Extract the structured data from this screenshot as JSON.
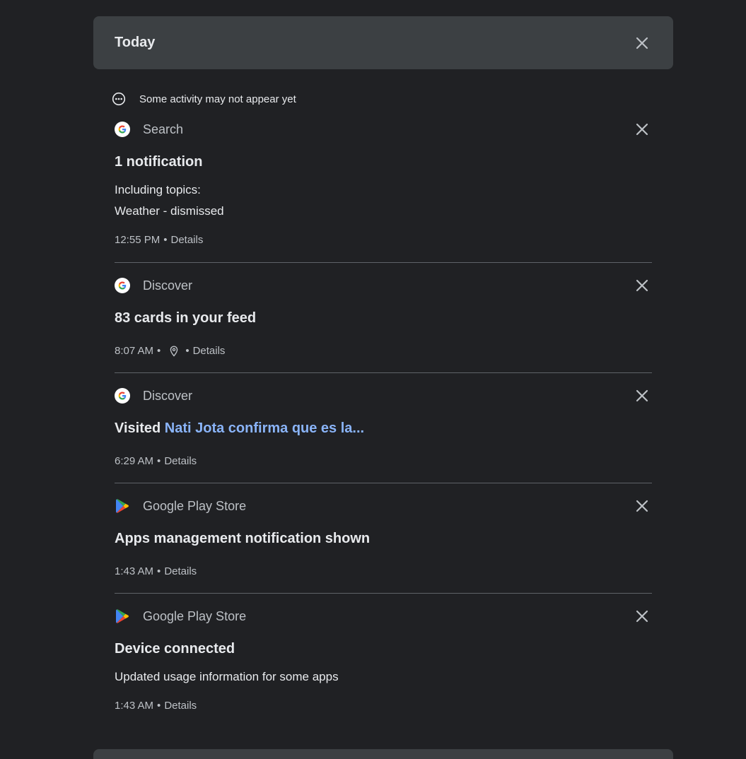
{
  "day": {
    "title": "Today"
  },
  "notice": {
    "text": "Some activity may not appear yet"
  },
  "cards": [
    {
      "app": "Search",
      "title": "1 notification",
      "lines": [
        "Including topics:",
        "Weather - dismissed"
      ],
      "time": "12:55 PM",
      "details": "Details"
    },
    {
      "app": "Discover",
      "title": "83 cards in your feed",
      "time": "8:07 AM",
      "details": "Details"
    },
    {
      "app": "Discover",
      "title_prefix": "Visited",
      "title_link": "Nati Jota confirma que es la...",
      "time": "6:29 AM",
      "details": "Details"
    },
    {
      "app": "Google Play Store",
      "title": "Apps management notification shown",
      "time": "1:43 AM",
      "details": "Details"
    },
    {
      "app": "Google Play Store",
      "title": "Device connected",
      "lines": [
        "Updated usage information for some apps"
      ],
      "time": "1:43 AM",
      "details": "Details"
    }
  ],
  "separator": "•",
  "colors": {
    "background": "#202124",
    "header_bg": "#3c4043",
    "link": "#8ab4f8",
    "divider": "#5f6368"
  }
}
